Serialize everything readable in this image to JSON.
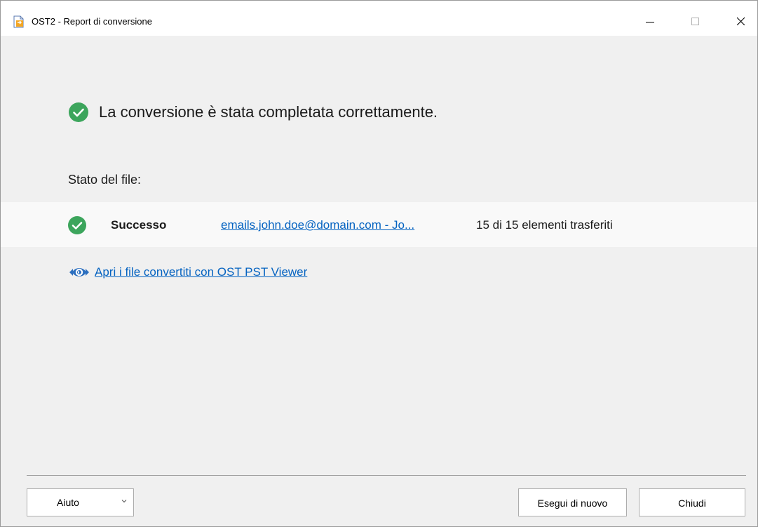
{
  "window": {
    "title": "OST2 - Report di conversione"
  },
  "icons": {
    "app": "app-document-icon",
    "minimize": "minimize-icon",
    "maximize": "maximize-icon",
    "close": "close-icon",
    "success": "check-circle-icon",
    "viewer": "eye-viewer-icon",
    "dropdown": "chevron-down-icon"
  },
  "colors": {
    "success_green": "#3ca55c",
    "link_blue": "#0563c1",
    "background": "#f0f0f0"
  },
  "main": {
    "success_message": "La conversione è stata completata correttamente.",
    "status_label": "Stato del file:",
    "file_rows": [
      {
        "status": "Successo",
        "file": "emails.john.doe@domain.com - Jo...",
        "count": "15 di 15 elementi trasferiti"
      }
    ],
    "viewer_link": "Apri i file convertiti con OST PST Viewer"
  },
  "footer": {
    "help_label": "Aiuto",
    "run_again_label": "Esegui di nuovo",
    "close_label": "Chiudi"
  }
}
